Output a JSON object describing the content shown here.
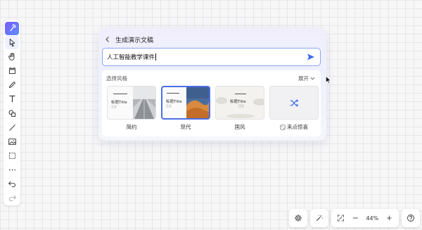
{
  "toolbar": {
    "items": [
      "ai-icon",
      "select-icon",
      "hand-icon",
      "frame-icon",
      "pen-icon",
      "text-icon",
      "shape-icon",
      "line-icon",
      "image-icon",
      "crop-frame-icon",
      "more-icon",
      "undo-icon",
      "redo-icon"
    ]
  },
  "panel": {
    "title": "生成演示文稿",
    "prompt_value": "人工智能教学课件",
    "style_label": "选择风格",
    "expand_label": "展开",
    "styles": [
      {
        "label": "简约",
        "thumb_title": "标题Title",
        "thumb_sub": "正文"
      },
      {
        "label": "现代",
        "thumb_title": "标题Title",
        "thumb_sub": "正文"
      },
      {
        "label": "国风",
        "thumb_title": "标题Title",
        "thumb_sub": "正文"
      },
      {
        "label": "来点惊喜"
      }
    ],
    "selected_style": "现代"
  },
  "bottom": {
    "zoom": "44%"
  },
  "colors": {
    "accent": "#4b6ee8",
    "brand": "#7b5cff"
  }
}
